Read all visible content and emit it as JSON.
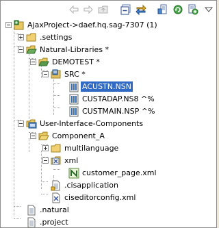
{
  "toolbar": {
    "buttons": [
      {
        "icon": "back-arrow-icon"
      },
      {
        "icon": "forward-arrow-icon"
      },
      {
        "icon": "up-folder-icon"
      },
      {
        "icon": "collapse-all-icon"
      },
      {
        "icon": "link-with-editor-icon"
      },
      {
        "icon": "new-file-icon"
      },
      {
        "icon": "refresh-icon"
      },
      {
        "icon": "filter-icon"
      },
      {
        "icon": "view-menu-icon"
      }
    ]
  },
  "tree": [
    {
      "label": "AjaxProject->daef.hq.sag-7307 (1)",
      "icon": "project-icon"
    },
    {
      "label": ".settings",
      "icon": "folder-icon"
    },
    {
      "label": "Natural-Libraries  *",
      "icon": "open-folder-icon"
    },
    {
      "label": "DEMOTEST  *",
      "icon": "library-icon"
    },
    {
      "label": "SRC  *",
      "icon": "src-folder-icon"
    },
    {
      "label": "ACUSTN.NSN",
      "icon": "natural-object-icon",
      "selected": true
    },
    {
      "label": "CUSTADAP.NS8  ^%",
      "icon": "natural-object-icon"
    },
    {
      "label": "CUSTMAIN.NSP  ^%",
      "icon": "natural-object-icon"
    },
    {
      "label": "User-Interface-Components",
      "icon": "ui-components-icon"
    },
    {
      "label": "Component_A",
      "icon": "component-folder-icon"
    },
    {
      "label": "multilanguage",
      "icon": "folder-icon"
    },
    {
      "label": "xml",
      "icon": "xml-folder-icon"
    },
    {
      "label": "customer_page.xml",
      "icon": "page-file-icon"
    },
    {
      "label": ".cisapplication",
      "icon": "file-icon"
    },
    {
      "label": "ciseditorconfig.xml",
      "icon": "xml-file-icon"
    },
    {
      "label": ".natural",
      "icon": "natural-file-icon"
    },
    {
      "label": ".project",
      "icon": "project-file-icon"
    }
  ]
}
